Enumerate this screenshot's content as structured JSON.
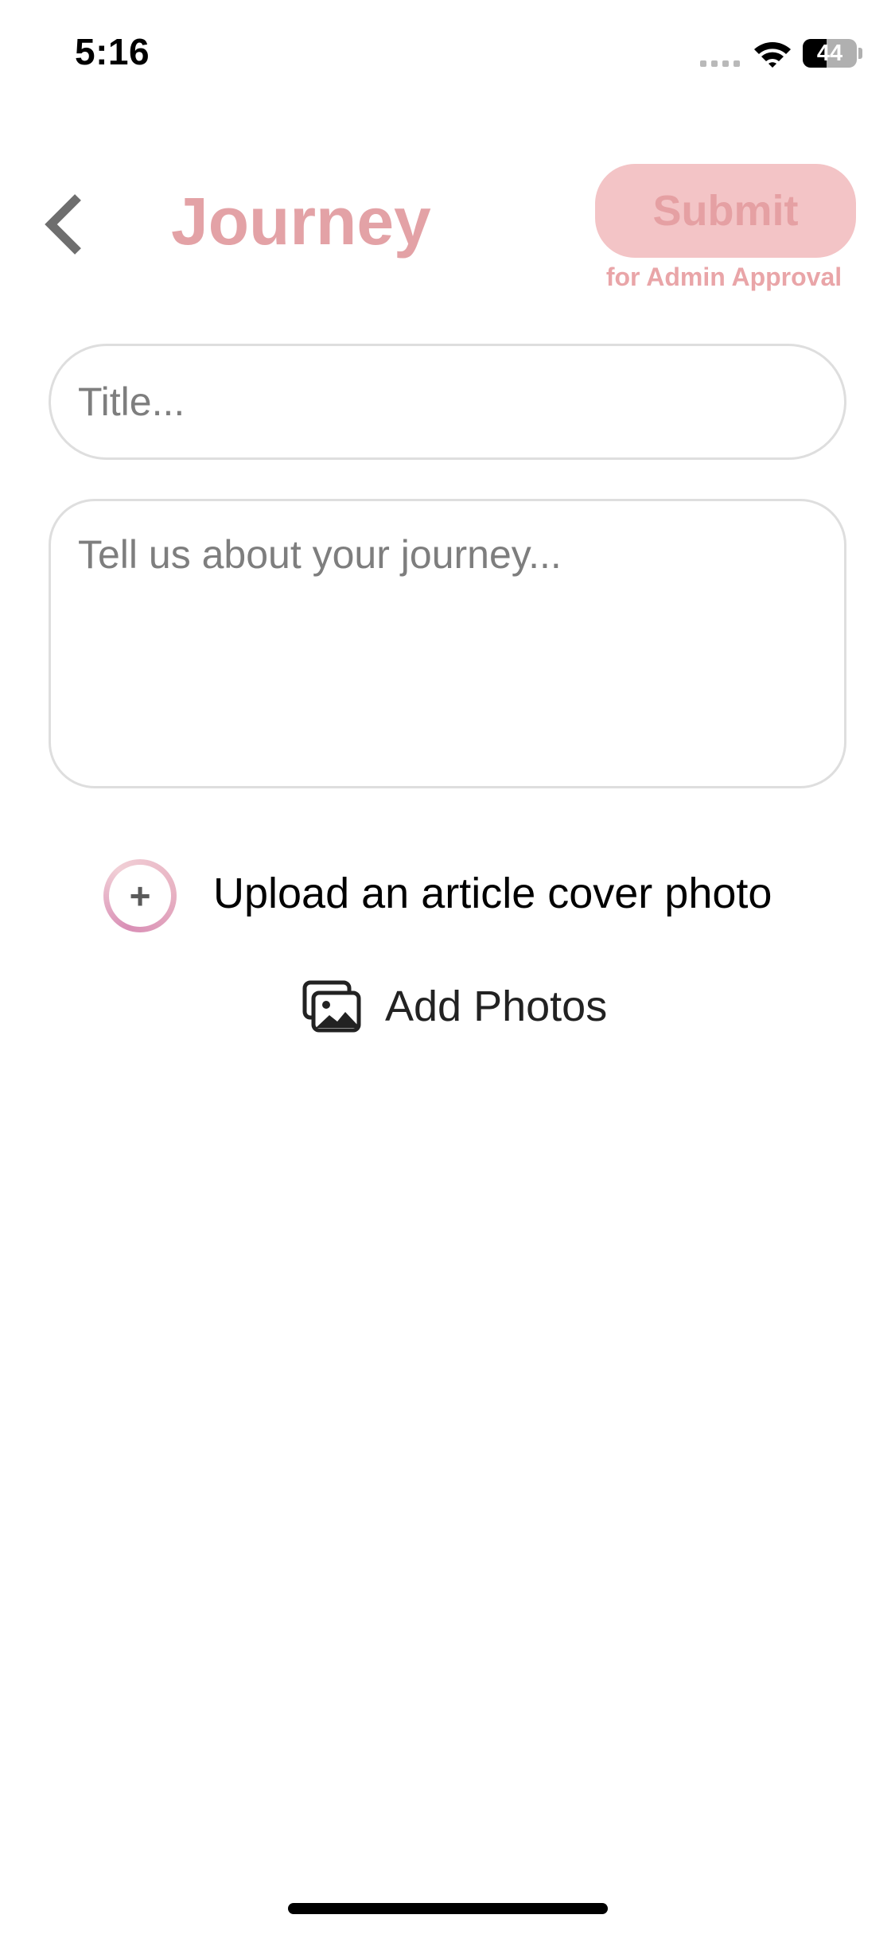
{
  "status_bar": {
    "time": "5:16",
    "battery_level": "44",
    "icons": [
      "cellular-signal-icon",
      "wifi-icon",
      "battery-icon"
    ]
  },
  "header": {
    "back_icon": "chevron-left-icon",
    "title": "Journey",
    "submit_label": "Submit",
    "submit_sublabel": "for Admin Approval"
  },
  "form": {
    "title_placeholder": "Title...",
    "title_value": "",
    "story_placeholder": "Tell us about your journey...",
    "story_value": ""
  },
  "actions": {
    "upload_cover_icon": "plus-circle-icon",
    "upload_cover_label": "Upload an article cover photo",
    "add_photos_icon": "photo-gallery-icon",
    "add_photos_label": "Add Photos"
  },
  "colors": {
    "accent": "#e3a2a6",
    "submit_background": "#f3c4c6",
    "input_border": "#dedede",
    "placeholder": "#7e7e7e"
  }
}
